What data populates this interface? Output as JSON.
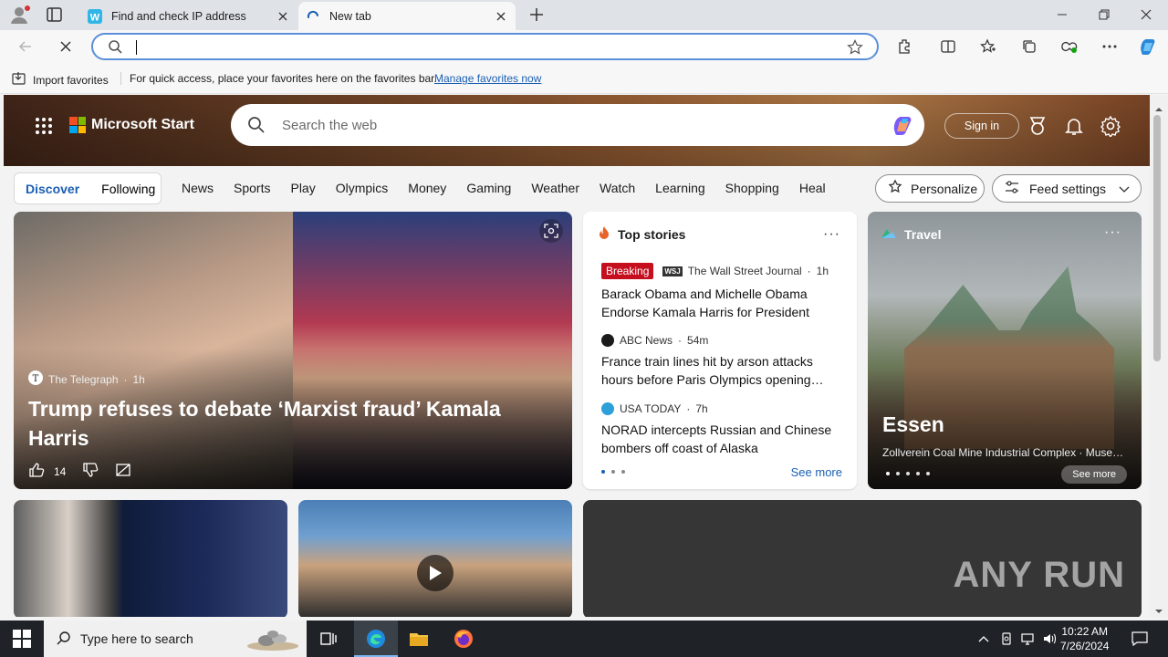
{
  "tabs": [
    {
      "title": "Find and check IP address",
      "favicon": "w-icon"
    },
    {
      "title": "New tab",
      "favicon": "loading-icon"
    }
  ],
  "address_bar": {
    "value": "",
    "placeholder": ""
  },
  "favorites_bar": {
    "import_label": "Import favorites",
    "hint": "For quick access, place your favorites here on the favorites bar.",
    "manage_link": "Manage favorites now"
  },
  "header": {
    "brand": "Microsoft Start",
    "search_placeholder": "Search the web",
    "sign_in": "Sign in"
  },
  "feed_tabs": {
    "discover": "Discover",
    "following": "Following"
  },
  "categories": [
    "News",
    "Sports",
    "Play",
    "Olympics",
    "Money",
    "Gaming",
    "Weather",
    "Watch",
    "Learning",
    "Shopping",
    "Heal"
  ],
  "buttons": {
    "personalize": "Personalize",
    "feed_settings": "Feed settings"
  },
  "hero": {
    "source": "The Telegraph",
    "age": "1h",
    "title": "Trump refuses to debate ‘Marxist fraud’ Kamala Harris",
    "likes": "14"
  },
  "top_stories": {
    "heading": "Top stories",
    "items": [
      {
        "badge": "Breaking",
        "source": "The Wall Street Journal",
        "age": "1h",
        "headline": "Barack Obama and Michelle Obama Endorse Kamala Harris for President"
      },
      {
        "source": "ABC News",
        "age": "54m",
        "headline": "France train lines hit by arson attacks hours before Paris Olympics opening…"
      },
      {
        "source": "USA TODAY",
        "age": "7h",
        "headline": "NORAD intercepts Russian and Chinese bombers off coast of Alaska"
      }
    ],
    "see_more": "See more"
  },
  "travel": {
    "heading": "Travel",
    "city": "Essen",
    "subtitle": "Zollverein Coal Mine Industrial Complex · Museu…",
    "see_more": "See more"
  },
  "ad_watermark": "ANY RUN",
  "taskbar": {
    "search_placeholder": "Type here to search",
    "time": "10:22 AM",
    "date": "7/26/2024"
  },
  "colors": {
    "accent": "#1a5fb4",
    "breaking": "#c50f1f",
    "omnibox_border": "#5b8fd9"
  }
}
